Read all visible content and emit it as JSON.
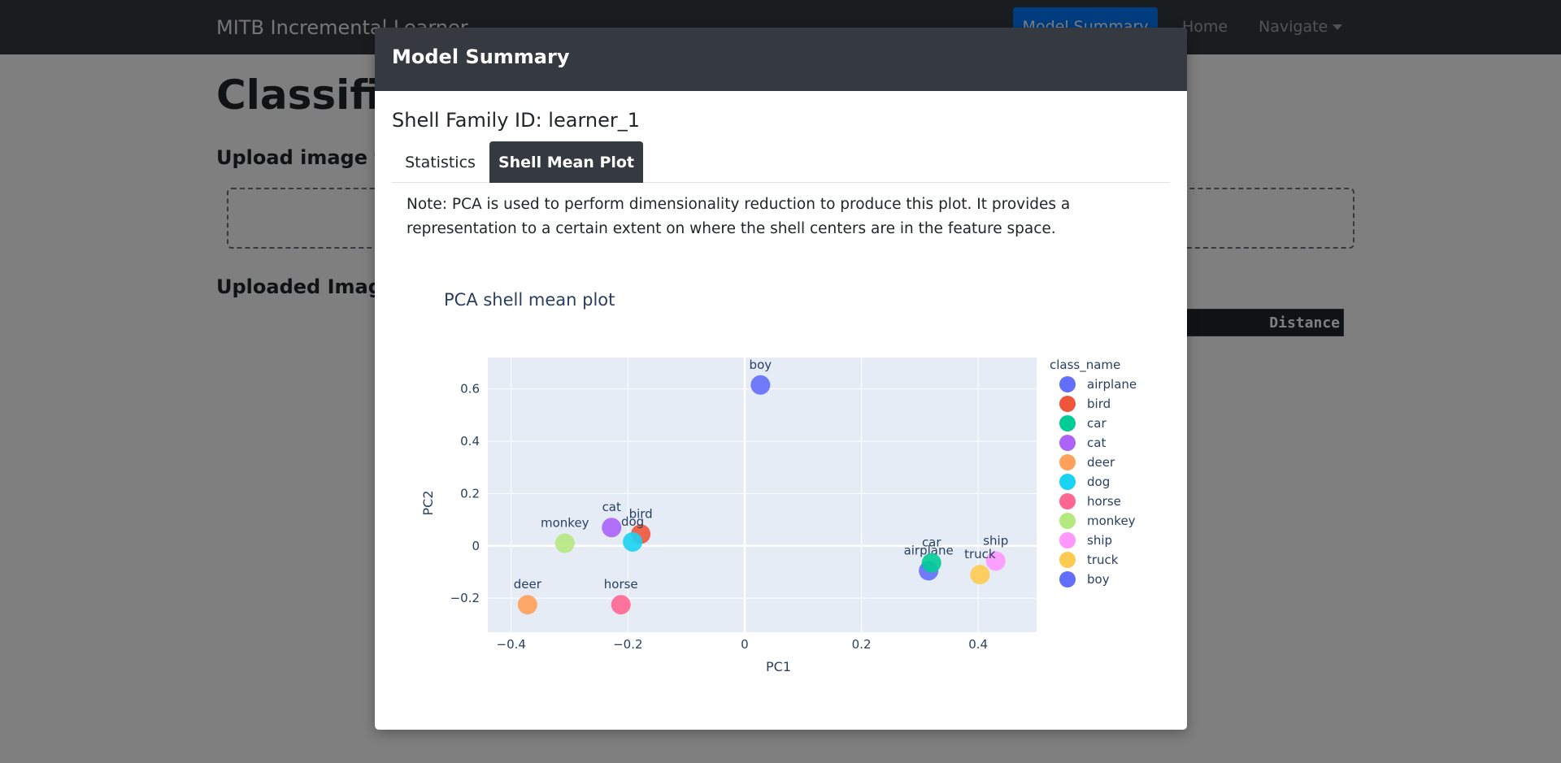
{
  "navbar": {
    "brand": "MITB Incremental Learner",
    "model_summary_button": "Model Summary",
    "home_link": "Home",
    "navigate_link": "Navigate"
  },
  "page": {
    "title": "Classifica",
    "upload_label": "Upload image to",
    "uploaded_label": "Uploaded Image",
    "distance_header": "Distance"
  },
  "modal": {
    "title": "Model Summary",
    "family_id": "Shell Family ID: learner_1",
    "tabs": [
      {
        "label": "Statistics",
        "active": false
      },
      {
        "label": "Shell Mean Plot",
        "active": true
      }
    ],
    "note": "Note: PCA is used to perform dimensionality reduction to produce this plot. It provides a representation to a certain extent on where the shell centers are in the feature space."
  },
  "chart_data": {
    "type": "scatter",
    "title": "PCA shell mean plot",
    "xlabel": "PC1",
    "ylabel": "PC2",
    "xlim": [
      -0.44,
      0.5
    ],
    "ylim": [
      -0.33,
      0.72
    ],
    "xticks": [
      -0.4,
      -0.2,
      0,
      0.2,
      0.4
    ],
    "xtick_labels": [
      "−0.4",
      "−0.2",
      "0",
      "0.2",
      "0.4"
    ],
    "yticks": [
      -0.2,
      0,
      0.2,
      0.4,
      0.6
    ],
    "ytick_labels": [
      "−0.2",
      "0",
      "0.2",
      "0.4",
      "0.6"
    ],
    "grid": true,
    "legend_title": "class_name",
    "legend_position": "right",
    "series": [
      {
        "name": "airplane",
        "color": "#636EFA",
        "x": 0.315,
        "y": -0.095,
        "label": "airplane"
      },
      {
        "name": "bird",
        "color": "#EF553B",
        "x": -0.178,
        "y": 0.045,
        "label": "bird"
      },
      {
        "name": "car",
        "color": "#00CC96",
        "x": 0.32,
        "y": -0.065,
        "label": "car"
      },
      {
        "name": "cat",
        "color": "#AB63FA",
        "x": -0.228,
        "y": 0.07,
        "label": "cat"
      },
      {
        "name": "deer",
        "color": "#FFA15A",
        "x": -0.372,
        "y": -0.225,
        "label": "deer"
      },
      {
        "name": "dog",
        "color": "#19D3F3",
        "x": -0.192,
        "y": 0.015,
        "label": "dog"
      },
      {
        "name": "horse",
        "color": "#FF6692",
        "x": -0.212,
        "y": -0.225,
        "label": "horse"
      },
      {
        "name": "monkey",
        "color": "#B6E880",
        "x": -0.308,
        "y": 0.01,
        "label": "monkey"
      },
      {
        "name": "ship",
        "color": "#FF97FF",
        "x": 0.43,
        "y": -0.058,
        "label": "ship"
      },
      {
        "name": "truck",
        "color": "#FECB52",
        "x": 0.403,
        "y": -0.11,
        "label": "truck"
      },
      {
        "name": "boy",
        "color": "#636EFA",
        "x": 0.027,
        "y": 0.615,
        "label": "boy"
      }
    ]
  }
}
